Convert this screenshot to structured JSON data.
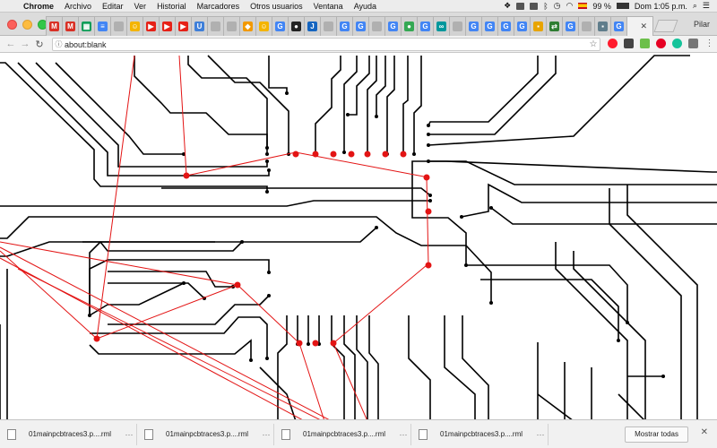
{
  "menubar": {
    "app_name": "Chrome",
    "items": [
      "Archivo",
      "Editar",
      "Ver",
      "Historial",
      "Marcadores",
      "Otros usuarios",
      "Ventana",
      "Ayuda"
    ],
    "battery": "99 %",
    "clock": "Dom 1:05 p.m."
  },
  "tabs": {
    "favicons": [
      {
        "icon": "gmail-icon",
        "color": "#d93025",
        "glyph": "M"
      },
      {
        "icon": "gmail-icon",
        "color": "#d93025",
        "glyph": "M"
      },
      {
        "icon": "sheets-icon",
        "color": "#0f9d58",
        "glyph": "▦"
      },
      {
        "icon": "docs-icon",
        "color": "#4285f4",
        "glyph": "≡"
      },
      {
        "icon": "page-icon",
        "color": "#b0b0b0",
        "glyph": ""
      },
      {
        "icon": "emoji-icon",
        "color": "#f4b400",
        "glyph": "☺"
      },
      {
        "icon": "youtube-icon",
        "color": "#e62117",
        "glyph": "▶"
      },
      {
        "icon": "youtube-icon",
        "color": "#e62117",
        "glyph": "▶"
      },
      {
        "icon": "youtube-icon",
        "color": "#e62117",
        "glyph": "▶"
      },
      {
        "icon": "app-icon",
        "color": "#3f7fd9",
        "glyph": "U"
      },
      {
        "icon": "page-icon",
        "color": "#b0b0b0",
        "glyph": ""
      },
      {
        "icon": "page-icon",
        "color": "#b0b0b0",
        "glyph": ""
      },
      {
        "icon": "maps-icon",
        "color": "#f29900",
        "glyph": "◆"
      },
      {
        "icon": "emoji-icon",
        "color": "#f4b400",
        "glyph": "☺"
      },
      {
        "icon": "google-icon",
        "color": "#4285f4",
        "glyph": "G"
      },
      {
        "icon": "github-icon",
        "color": "#222222",
        "glyph": "●"
      },
      {
        "icon": "j-icon",
        "color": "#1565c0",
        "glyph": "J"
      },
      {
        "icon": "page-icon",
        "color": "#b0b0b0",
        "glyph": ""
      },
      {
        "icon": "google-icon",
        "color": "#4285f4",
        "glyph": "G"
      },
      {
        "icon": "google-icon",
        "color": "#4285f4",
        "glyph": "G"
      },
      {
        "icon": "page-icon",
        "color": "#b0b0b0",
        "glyph": ""
      },
      {
        "icon": "google-icon",
        "color": "#4285f4",
        "glyph": "G"
      },
      {
        "icon": "leaf-icon",
        "color": "#34a853",
        "glyph": "●"
      },
      {
        "icon": "google-icon",
        "color": "#4285f4",
        "glyph": "G"
      },
      {
        "icon": "arduino-icon",
        "color": "#00979c",
        "glyph": "∞"
      },
      {
        "icon": "page-icon",
        "color": "#b0b0b0",
        "glyph": ""
      },
      {
        "icon": "google-icon",
        "color": "#4285f4",
        "glyph": "G"
      },
      {
        "icon": "google-icon",
        "color": "#4285f4",
        "glyph": "G"
      },
      {
        "icon": "google-icon",
        "color": "#4285f4",
        "glyph": "G"
      },
      {
        "icon": "google-icon",
        "color": "#4285f4",
        "glyph": "G"
      },
      {
        "icon": "app-icon",
        "color": "#e8a400",
        "glyph": "▪"
      },
      {
        "icon": "arrows-icon",
        "color": "#2e7d32",
        "glyph": "⇄"
      },
      {
        "icon": "google-icon",
        "color": "#4285f4",
        "glyph": "G"
      },
      {
        "icon": "page-icon",
        "color": "#b0b0b0",
        "glyph": ""
      },
      {
        "icon": "app-icon",
        "color": "#607d8b",
        "glyph": "▪"
      },
      {
        "icon": "google-icon",
        "color": "#4285f4",
        "glyph": "G"
      }
    ],
    "active_close": "✕",
    "profile": "Pilar"
  },
  "toolbar": {
    "url": "about:blank"
  },
  "canvas": {
    "trace_color": "#000000",
    "ratsnest_color": "#e31414",
    "pad_color": "#e31414"
  },
  "downloads": {
    "items": [
      "01mainpcbtraces3.p....rml",
      "01mainpcbtraces3.p....rml",
      "01mainpcbtraces3.p....rml",
      "01mainpcbtraces3.p....rml"
    ],
    "more_label": "···",
    "show_all": "Mostrar todas",
    "close": "✕"
  }
}
